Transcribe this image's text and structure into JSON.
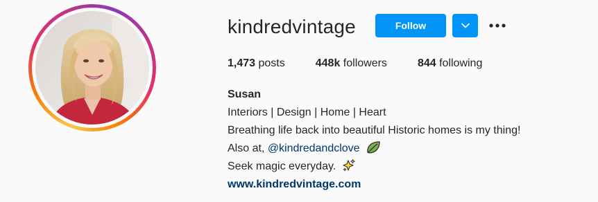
{
  "profile": {
    "username": "kindredvintage",
    "follow_label": "Follow",
    "stats": {
      "posts_count": "1,473",
      "posts_label": "posts",
      "followers_count": "448k",
      "followers_label": "followers",
      "following_count": "844",
      "following_label": "following"
    },
    "bio": {
      "name": "Susan",
      "line1": "Interiors | Design | Home | Heart",
      "line2": "Breathing life back into beautiful Historic homes is my thing!",
      "line3_prefix": "Also at, ",
      "line3_mention": "@kindredandclove",
      "line4": "Seek magic everyday.",
      "website": "www.kindredvintage.com"
    }
  },
  "colors": {
    "follow_button": "#0095f6",
    "link": "#00376b",
    "text": "#262626",
    "background": "#fafafa"
  },
  "icons": {
    "dropdown": "chevron-down-icon",
    "more": "more-options-icon",
    "leaf": "leaf-emoji-icon",
    "sparkles": "sparkles-emoji-icon"
  }
}
